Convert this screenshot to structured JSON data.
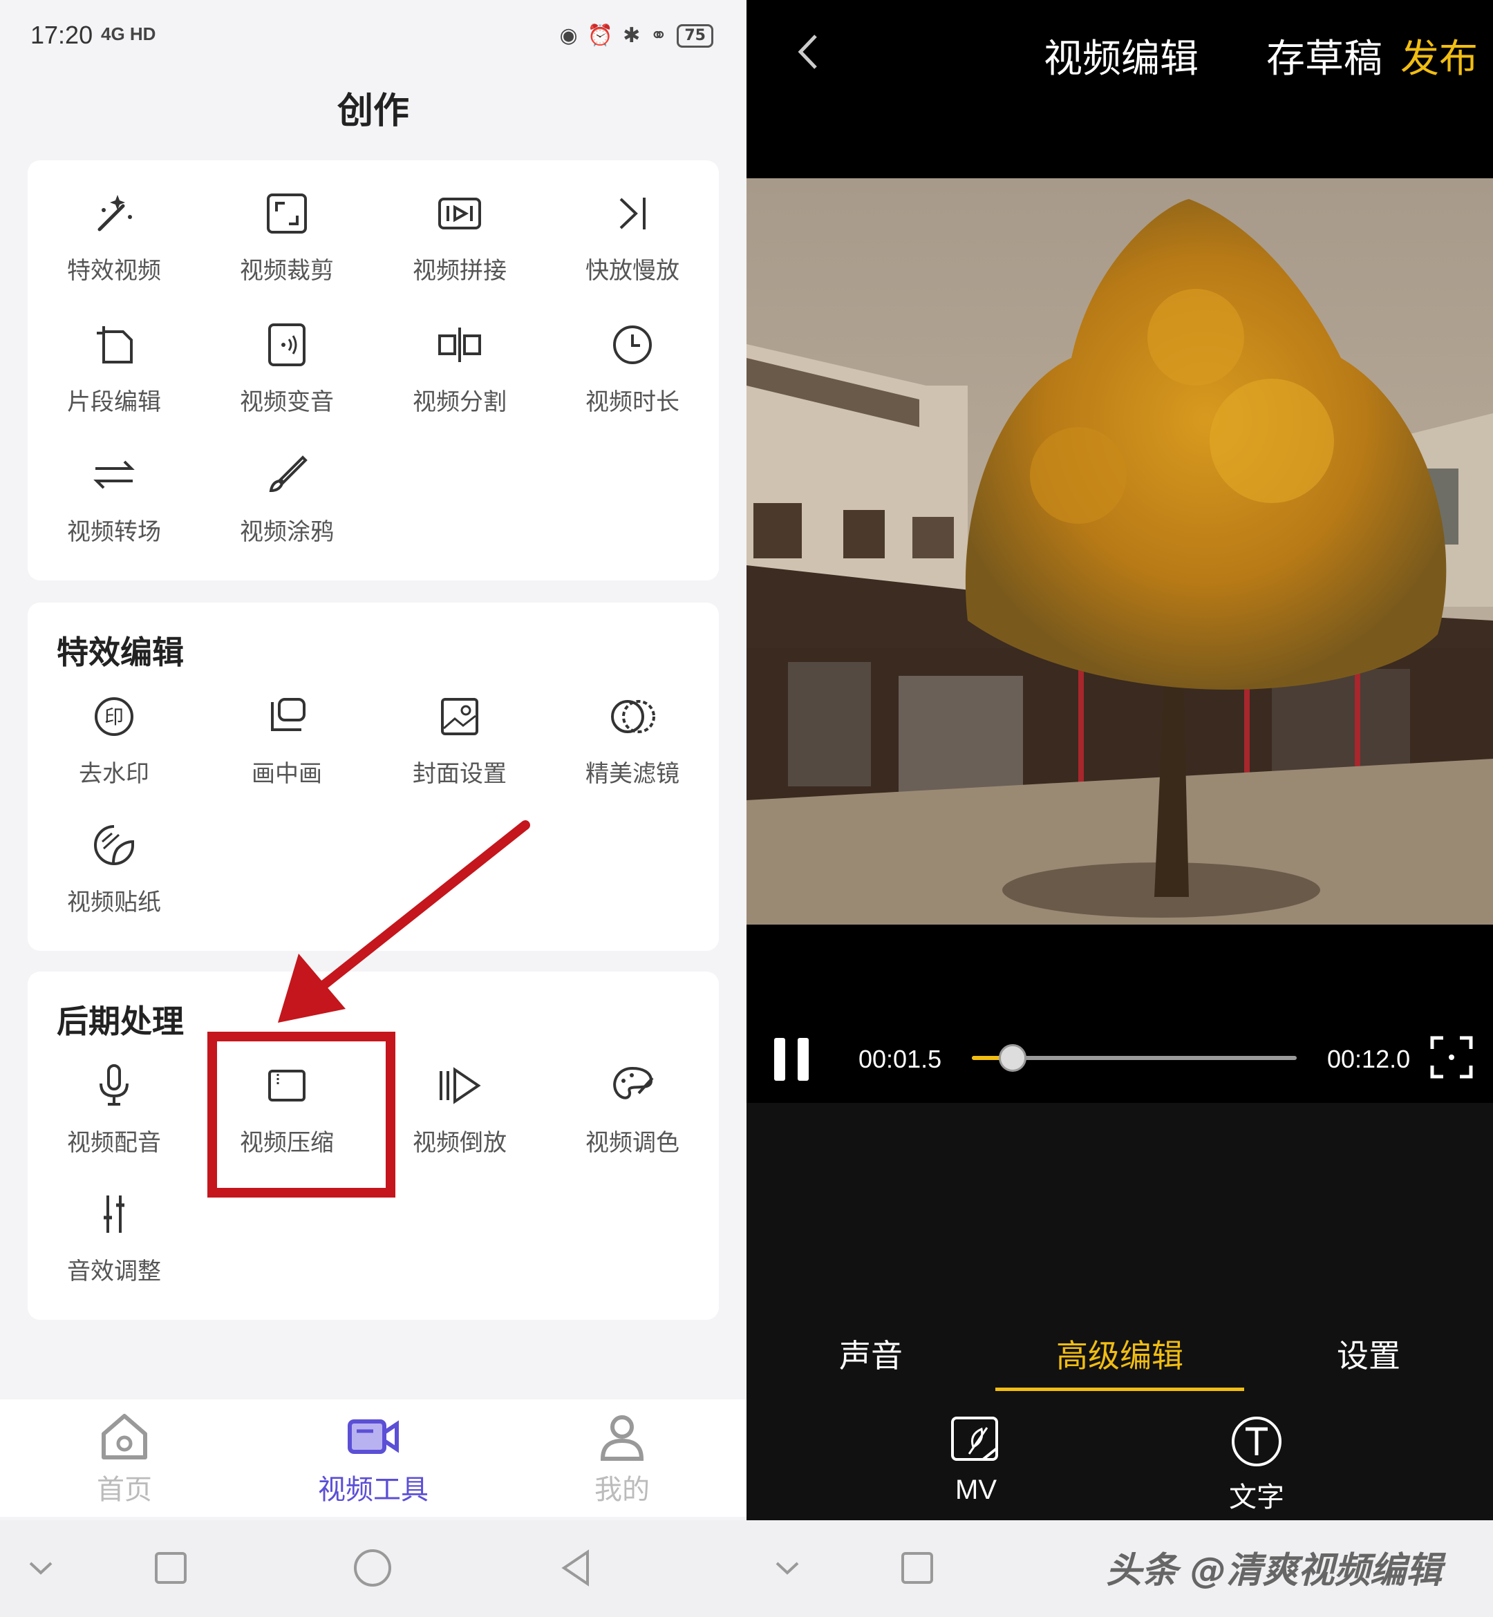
{
  "status_bar": {
    "time": "17:20",
    "indicators": "4G HD",
    "battery": "75"
  },
  "left": {
    "title": "创作",
    "sections": [
      {
        "heading": "",
        "tools": [
          {
            "label": "特效视频",
            "icon": "magic-wand-icon"
          },
          {
            "label": "视频裁剪",
            "icon": "crop-icon"
          },
          {
            "label": "视频拼接",
            "icon": "splice-icon"
          },
          {
            "label": "快放慢放",
            "icon": "speed-icon"
          },
          {
            "label": "片段编辑",
            "icon": "clip-edit-icon"
          },
          {
            "label": "视频变音",
            "icon": "voice-change-icon"
          },
          {
            "label": "视频分割",
            "icon": "split-icon"
          },
          {
            "label": "视频时长",
            "icon": "clock-icon"
          },
          {
            "label": "视频转场",
            "icon": "transition-icon"
          },
          {
            "label": "视频涂鸦",
            "icon": "brush-icon"
          }
        ]
      },
      {
        "heading": "特效编辑",
        "tools": [
          {
            "label": "去水印",
            "icon": "watermark-remove-icon"
          },
          {
            "label": "画中画",
            "icon": "picture-in-picture-icon"
          },
          {
            "label": "封面设置",
            "icon": "cover-image-icon"
          },
          {
            "label": "精美滤镜",
            "icon": "filter-icon"
          },
          {
            "label": "视频贴纸",
            "icon": "sticker-icon"
          }
        ]
      },
      {
        "heading": "后期处理",
        "tools": [
          {
            "label": "视频配音",
            "icon": "microphone-icon"
          },
          {
            "label": "视频压缩",
            "icon": "compress-icon"
          },
          {
            "label": "视频倒放",
            "icon": "reverse-play-icon"
          },
          {
            "label": "视频调色",
            "icon": "palette-icon"
          },
          {
            "label": "音效调整",
            "icon": "equalizer-icon"
          }
        ]
      }
    ],
    "bottom_nav": [
      {
        "label": "首页",
        "icon": "home-icon",
        "active": false
      },
      {
        "label": "视频工具",
        "icon": "video-tools-icon",
        "active": true
      },
      {
        "label": "我的",
        "icon": "profile-icon",
        "active": false
      }
    ]
  },
  "right": {
    "title": "视频编辑",
    "save_draft": "存草稿",
    "publish": "发布",
    "current_time": "00:01.5",
    "total_time": "00:12.0",
    "progress": 0.125,
    "tabs": [
      {
        "label": "声音",
        "active": false
      },
      {
        "label": "高级编辑",
        "active": true
      },
      {
        "label": "设置",
        "active": false
      }
    ],
    "tools": [
      {
        "label": "MV",
        "icon": "mv-icon"
      },
      {
        "label": "文字",
        "icon": "text-icon"
      }
    ]
  },
  "watermark": "头条 @清爽视频编辑",
  "colors": {
    "accent_purple": "#5b4fd6",
    "accent_yellow": "#f1bd12",
    "highlight_red": "#c4161c"
  }
}
